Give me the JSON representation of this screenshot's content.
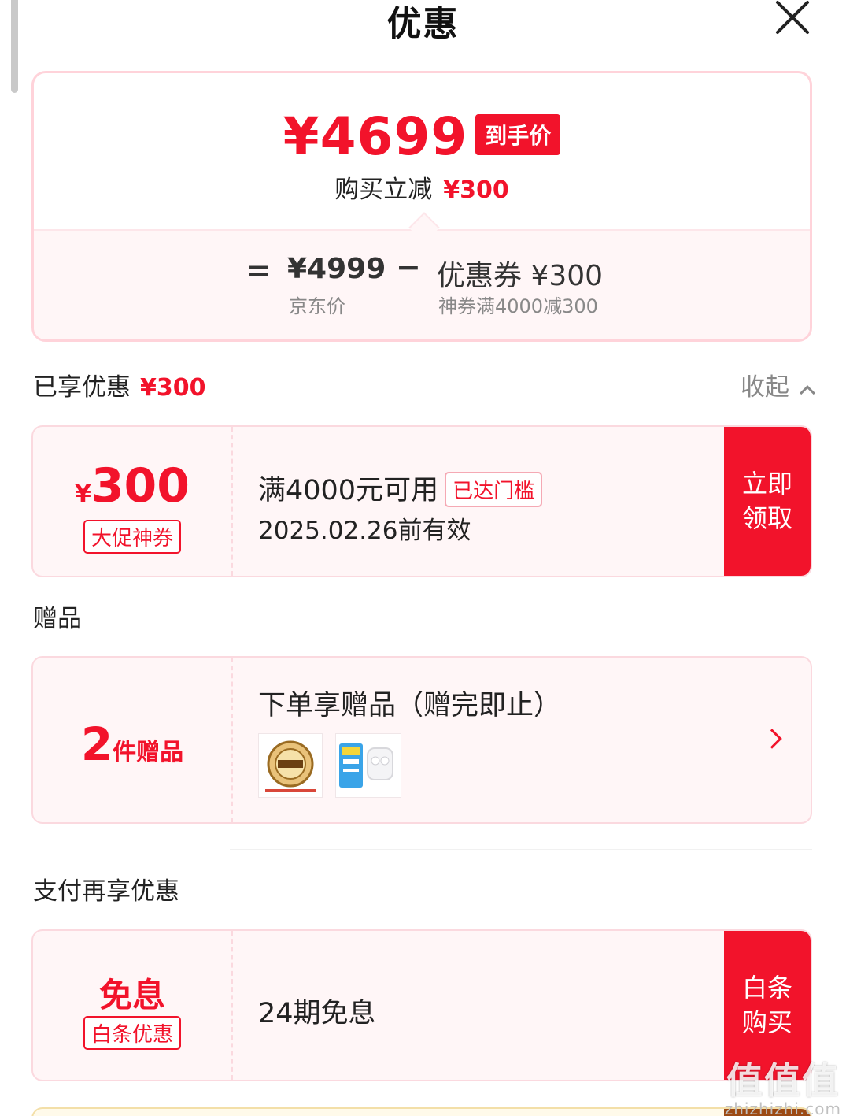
{
  "header": {
    "title": "优惠"
  },
  "summary": {
    "final_price": "¥4699",
    "final_price_tag": "到手价",
    "save_label": "购买立减",
    "save_amount": "¥300",
    "equals": "=",
    "jd_price": "¥4999",
    "jd_price_label": "京东价",
    "minus": "−",
    "coupon": "优惠券 ¥300",
    "coupon_desc": "神券满4000减300"
  },
  "enjoyed": {
    "label": "已享优惠",
    "amount": "¥300",
    "collapse_label": "收起"
  },
  "coupon_card": {
    "currency": "¥",
    "amount": "300",
    "badge": "大促神券",
    "condition": "满4000元可用",
    "status_tag": "已达门槛",
    "expiry": "2025.02.26前有效",
    "action_line1": "立即",
    "action_line2": "领取"
  },
  "gifts": {
    "section_title": "赠品",
    "count": "2",
    "count_label": "件赠品",
    "title": "下单享赠品（赠完即止）",
    "thumbnails": [
      "延长保修",
      "耳机"
    ]
  },
  "payment": {
    "section_title": "支付再享优惠",
    "label": "免息",
    "badge": "白条优惠",
    "desc": "24期免息",
    "action_line1": "白条",
    "action_line2": "购买"
  },
  "watermark": {
    "logo": "值值值",
    "url": "zhizhizhi.com"
  },
  "colors": {
    "accent": "#f2132b",
    "card_bg": "#fff6f7",
    "card_border": "#fbd9df"
  }
}
